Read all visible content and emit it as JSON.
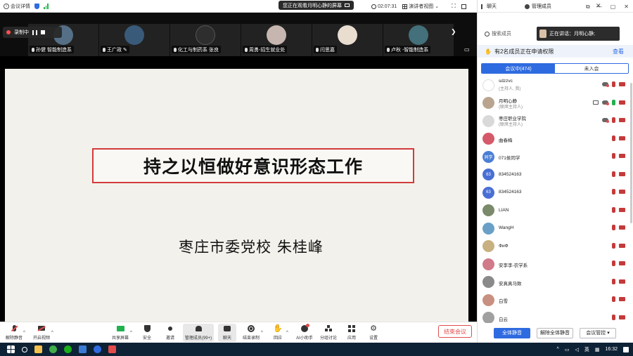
{
  "window": {
    "meeting_info_label": "会议详情",
    "watching_label": "您正在观看月明心静的屏幕",
    "watching_icon": "screen-share-icon",
    "timer": "02:07:31",
    "view_label": "演讲者视图"
  },
  "panel_header": {
    "chat_label": "聊天",
    "members_label": "管理成员"
  },
  "recording": {
    "label": "录制中"
  },
  "participants_strip": [
    {
      "name": "孙健  智能制造系",
      "color": "#556f86"
    },
    {
      "name": "王广政",
      "color": "#3a5a7a"
    },
    {
      "name": "化工与制药系  张良",
      "color": "#2e2e2e"
    },
    {
      "name": "周勇-招生就业处",
      "color": "#c7b6b0"
    },
    {
      "name": "闫思嘉",
      "color": "#e9ddd0"
    },
    {
      "name": "卢秋  -智能制造系",
      "color": "#43707a"
    }
  ],
  "slide": {
    "title": "持之以恒做好意识形态工作",
    "author": "枣庄市委党校   朱桂峰"
  },
  "toolbar": {
    "mute": "解除静音",
    "video": "开启视频",
    "share": "共享屏幕",
    "security": "安全",
    "invite": "邀请",
    "members": "管理成员(99+)",
    "chat": "聊天",
    "record": "结束录制",
    "reactions": "回应",
    "ai": "AI小助手",
    "breakout": "分组讨论",
    "apps": "应用",
    "settings": "设置",
    "end": "结束会议"
  },
  "members_panel": {
    "search_placeholder": "搜索成员",
    "speaking_label": "正在讲话：月明心静;",
    "notice": "有2名成员正在申请权限",
    "notice_action": "查看",
    "tab_in": "会议中(474)",
    "tab_out": "未入会",
    "members": [
      {
        "name": "sdzzvc",
        "role": "(主持人, 我)",
        "avatar": "#ffffff",
        "avatar_text": "",
        "share": false,
        "cloud": true,
        "mic_on": false
      },
      {
        "name": "月明心静",
        "role": "(联席主持人)",
        "avatar": "#b9a58f",
        "avatar_text": "",
        "share": true,
        "cloud": true,
        "mic_on": true
      },
      {
        "name": "枣庄职业学院",
        "role": "(联席主持人)",
        "avatar": "#d9d9d9",
        "avatar_text": "",
        "share": false,
        "cloud": true,
        "mic_on": false
      },
      {
        "name": "曲春梅",
        "role": "",
        "avatar": "#d45a6a",
        "avatar_text": "",
        "share": false,
        "cloud": false,
        "mic_on": false
      },
      {
        "name": "071侯同学",
        "role": "",
        "avatar": "#4a7fd4",
        "avatar_text": "同学",
        "share": false,
        "cloud": false,
        "mic_on": false
      },
      {
        "name": "834524163",
        "role": "",
        "avatar": "#4a6fd4",
        "avatar_text": "63",
        "share": false,
        "cloud": false,
        "mic_on": false
      },
      {
        "name": "834524163",
        "role": "",
        "avatar": "#4a6fd4",
        "avatar_text": "63",
        "share": false,
        "cloud": false,
        "mic_on": false
      },
      {
        "name": "LIAN",
        "role": "",
        "avatar": "#7a8a6a",
        "avatar_text": "",
        "share": false,
        "cloud": false,
        "mic_on": false
      },
      {
        "name": "WangH",
        "role": "",
        "avatar": "#6aa0c8",
        "avatar_text": "",
        "share": false,
        "cloud": false,
        "mic_on": false
      },
      {
        "name": "ФиФ",
        "role": "",
        "avatar": "#c8b080",
        "avatar_text": "",
        "share": false,
        "cloud": false,
        "mic_on": false
      },
      {
        "name": "安李李-农学系",
        "role": "",
        "avatar": "#d07a8a",
        "avatar_text": "",
        "share": false,
        "cloud": false,
        "mic_on": false
      },
      {
        "name": "安真真马致",
        "role": "",
        "avatar": "#8a8a8a",
        "avatar_text": "",
        "share": false,
        "cloud": false,
        "mic_on": false
      },
      {
        "name": "白雪",
        "role": "",
        "avatar": "#c89080",
        "avatar_text": "",
        "share": false,
        "cloud": false,
        "mic_on": false
      },
      {
        "name": "白云",
        "role": "",
        "avatar": "#a0a0a0",
        "avatar_text": "",
        "share": false,
        "cloud": false,
        "mic_on": false
      }
    ],
    "mute_all": "全体静音",
    "unmute_all": "解除全体静音",
    "control": "会议管控"
  },
  "taskbar": {
    "lang": "英",
    "time": "16:32"
  }
}
